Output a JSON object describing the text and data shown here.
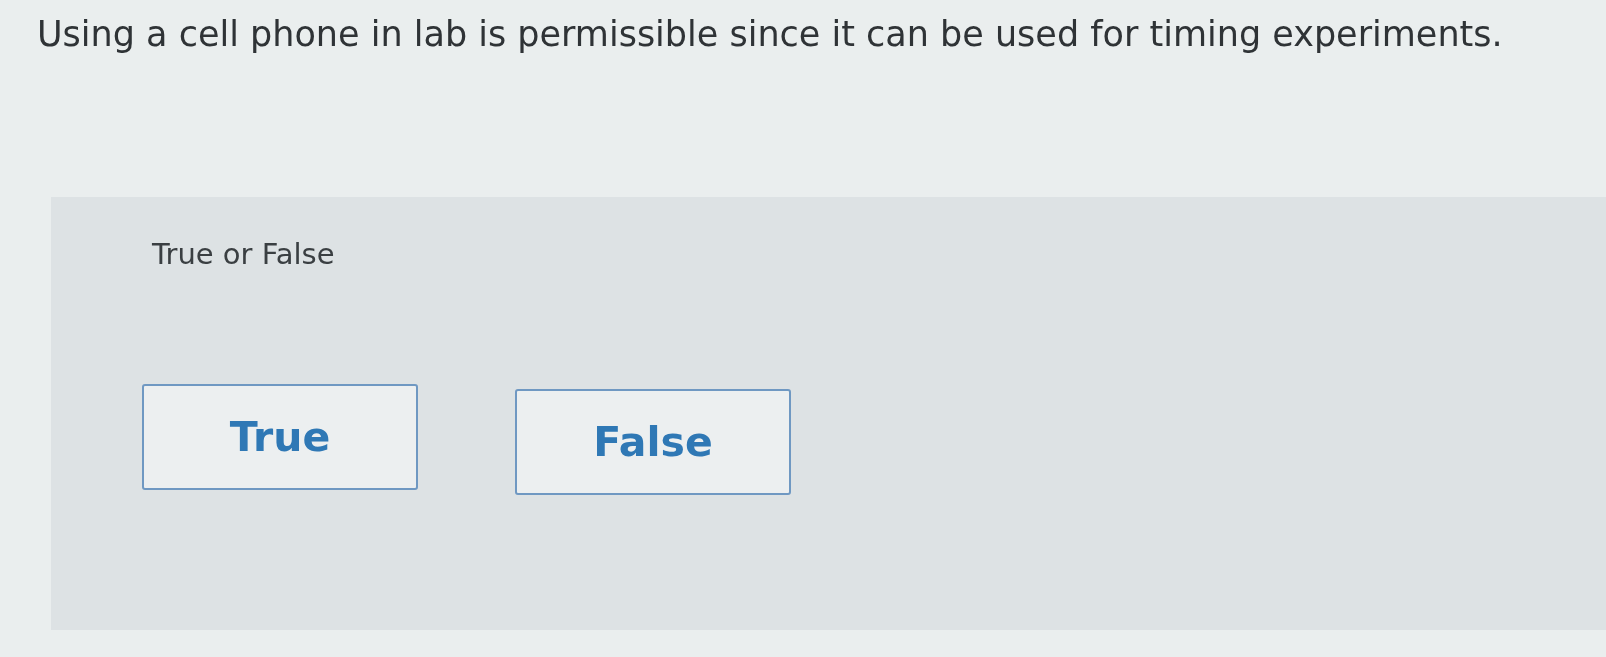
{
  "question": "Using a cell phone in lab is permissible since it can be used for timing experiments.",
  "answer_panel": {
    "prompt": "True or False",
    "options": [
      {
        "label": "True",
        "selected": false
      },
      {
        "label": "False",
        "selected": false
      }
    ]
  }
}
